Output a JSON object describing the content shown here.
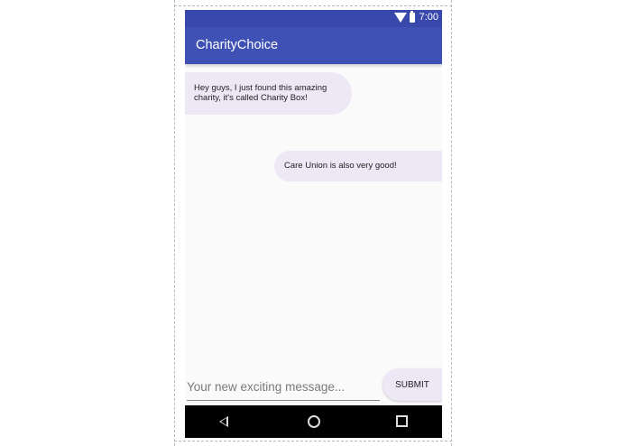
{
  "status_bar": {
    "time": "7:00",
    "icons": [
      "wifi-icon",
      "battery-icon"
    ]
  },
  "app_bar": {
    "title": "CharityChoice"
  },
  "messages": [
    {
      "text": "Hey guys, I just found this amazing charity, it's called Charity Box!",
      "side": "left"
    },
    {
      "text": "Care Union is also very good!",
      "side": "right"
    }
  ],
  "composer": {
    "placeholder": "Your new exciting message...",
    "value": "",
    "submit_label": "SUBMIT"
  },
  "nav_bar": {
    "icons": [
      "back-icon",
      "home-icon",
      "recents-icon"
    ]
  },
  "colors": {
    "status_bar": "#3949ab",
    "app_bar": "#3f51b5",
    "bubble": "#ede7f6",
    "background": "#fafafa"
  }
}
